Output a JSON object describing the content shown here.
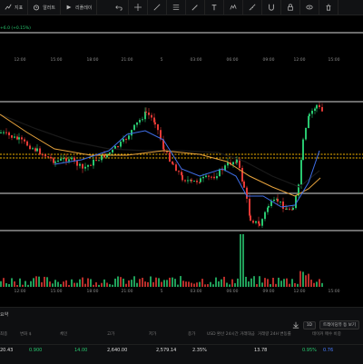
{
  "topbar": {
    "items": [
      {
        "name": "settings",
        "label": "지표"
      },
      {
        "name": "compare",
        "label": "알러트"
      },
      {
        "name": "replay",
        "label": "리플레이"
      }
    ],
    "tools": [
      "undo-icon",
      "redo-icon",
      "crosshair-icon",
      "trendline-icon",
      "fib-icon",
      "brush-icon",
      "text-icon",
      "ruler-icon",
      "magnet-icon",
      "lock-icon",
      "eye-icon"
    ]
  },
  "chart": {
    "price_change": "+6.0 (+0.15%)",
    "time_labels_top": [
      "12:00",
      "15:00",
      "18:00",
      "21:00",
      "5",
      "03:00",
      "06:00",
      "09:00",
      "12:00",
      "15:00"
    ],
    "time_labels_bottom": [
      "12:00",
      "15:00",
      "18:00",
      "21:00",
      "5",
      "03:00",
      "06:00",
      "09:00",
      "12:00",
      "15:00"
    ],
    "colors": {
      "up": "#28c76f",
      "down": "#e53935",
      "h_line": "#d7d7d7",
      "dotted": "#f5b400",
      "ma_orange": "#e6a23c",
      "ma_blue": "#3f6fe8",
      "ma_black": "#1a1a1a"
    }
  },
  "bottom_panel": {
    "title": "요약",
    "download_icon": "download-icon",
    "dropdown": "1D",
    "right_label": "트레이딩뷰 등 보기",
    "headers": [
      "최종",
      "변화 $",
      "체인",
      "고가",
      "저가",
      "종가",
      "USD 환산 24시간 거래대금",
      "거래량 24H 변동률",
      "테이커 매수 비중"
    ],
    "values": [
      "20.43",
      "0.900",
      "14.00",
      "2,640.00",
      "2,579.14",
      "2.35%",
      "13.78",
      "0.95%",
      "0.76"
    ]
  }
}
